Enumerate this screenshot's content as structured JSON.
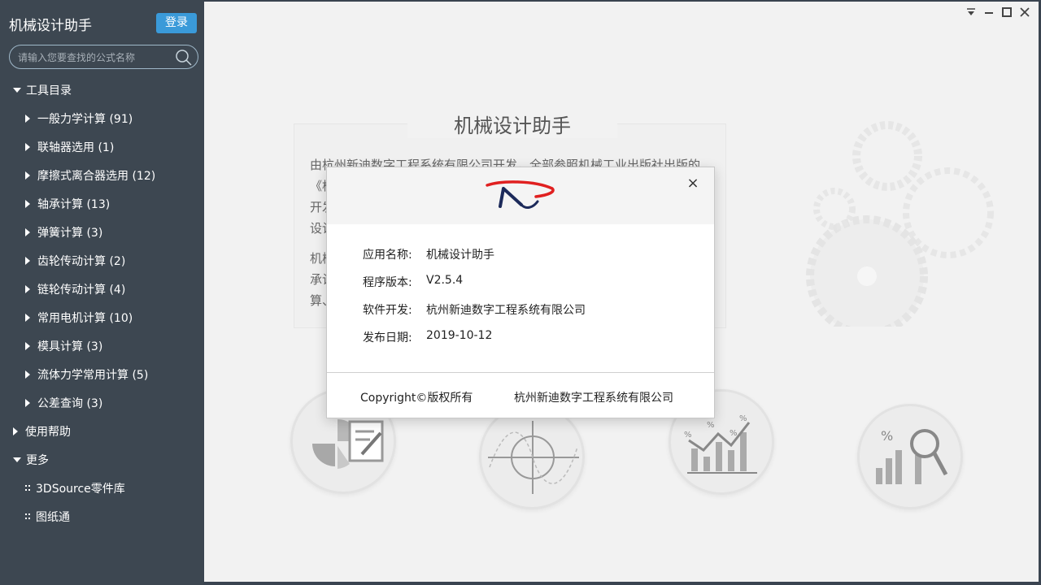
{
  "sidebar": {
    "app_title": "机械设计助手",
    "login_label": "登录",
    "search_placeholder": "请输入您要查找的公式名称",
    "tree": {
      "root_label": "工具目录",
      "items": [
        {
          "label": "一般力学计算 (91)"
        },
        {
          "label": "联轴器选用 (1)"
        },
        {
          "label": "摩擦式离合器选用 (12)"
        },
        {
          "label": "轴承计算 (13)"
        },
        {
          "label": "弹簧计算 (3)"
        },
        {
          "label": "齿轮传动计算 (2)"
        },
        {
          "label": "链轮传动计算 (4)"
        },
        {
          "label": "常用电机计算 (10)"
        },
        {
          "label": "模具计算 (3)"
        },
        {
          "label": "流体力学常用计算 (5)"
        },
        {
          "label": "公差查询 (3)"
        }
      ],
      "help_label": "使用帮助",
      "more_label": "更多",
      "more_items": [
        {
          "label": "3DSource零件库"
        },
        {
          "label": "图纸通"
        }
      ]
    }
  },
  "main": {
    "bg_title": "机械设计助手",
    "bg_text_line1": "由杭州新迪数字工程系统有限公司开发，全部参照机械工业出版社出版的",
    "bg_text_line2": "《杭",
    "bg_text_line3": "开发",
    "bg_text_line4": "设计",
    "bg_text2_line1": "机械",
    "bg_text2_line2": "承计",
    "bg_text2_line3": "算、"
  },
  "dialog": {
    "rows": [
      {
        "label": "应用名称:",
        "value": "机械设计助手"
      },
      {
        "label": "程序版本:",
        "value": "V2.5.4"
      },
      {
        "label": "软件开发:",
        "value": "杭州新迪数字工程系统有限公司"
      },
      {
        "label": "发布日期:",
        "value": "2019-10-12"
      }
    ],
    "footer_left": "Copyright©版权所有",
    "footer_right": "杭州新迪数字工程系统有限公司",
    "close_glyph": "×"
  },
  "colors": {
    "sidebar_bg": "#3d4751",
    "login_btn": "#3a9ad9",
    "main_bg": "#f2f2f2",
    "logo_red": "#e02020",
    "logo_navy": "#1c2a5a"
  }
}
